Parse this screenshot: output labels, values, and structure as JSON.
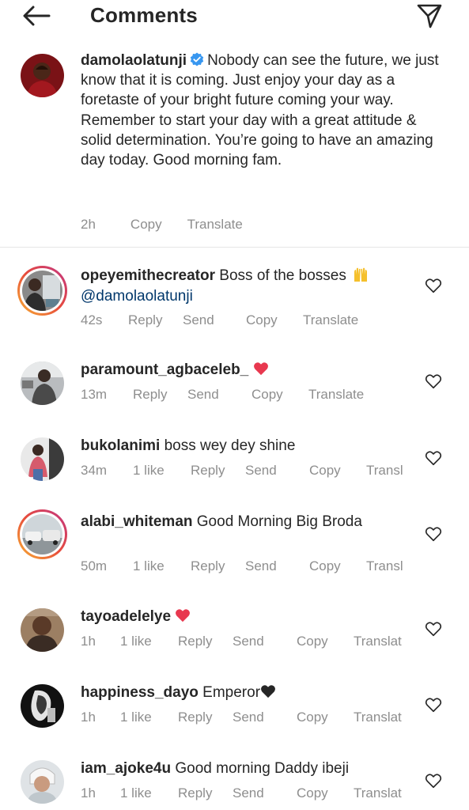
{
  "header": {
    "title": "Comments",
    "back_icon": "arrow-left-icon",
    "share_icon": "send-paper-plane-icon"
  },
  "caption": {
    "username": "damolaolatunji",
    "verified": true,
    "text": "Nobody can see the future, we just know that it is coming. Just enjoy your day as a foretaste of your bright future coming your way. Remember to start your day with a great attitude & solid determination. You’re going to have an amazing day today. Good morning fam.",
    "time": "2h",
    "copy_label": "Copy",
    "translate_label": "Translate"
  },
  "comments": [
    {
      "username": "opeyemithecreator",
      "text": "Boss of the bosses",
      "emoji": "raised-hands",
      "mention": "@damolaolatunji",
      "time": "42s",
      "actions": [
        "Reply",
        "Send",
        "Copy",
        "Translate"
      ]
    },
    {
      "username": "paramount_agbaceleb_",
      "text": "",
      "emoji": "red-heart",
      "time": "13m",
      "actions": [
        "Reply",
        "Send",
        "Copy",
        "Translate"
      ]
    },
    {
      "username": "bukolanimi",
      "text": "boss wey dey shine",
      "time": "34m",
      "likes": "1 like",
      "actions": [
        "Reply",
        "Send",
        "Copy",
        "Transl"
      ]
    },
    {
      "username": "alabi_whiteman",
      "text": "Good Morning Big Broda",
      "time": "50m",
      "likes": "1 like",
      "actions": [
        "Reply",
        "Send",
        "Copy",
        "Transl"
      ]
    },
    {
      "username": "tayoadelelye",
      "text": "",
      "emoji": "red-heart",
      "time": "1h",
      "likes": "1 like",
      "actions": [
        "Reply",
        "Send",
        "Copy",
        "Translat"
      ]
    },
    {
      "username": "happiness_dayo",
      "text": "Emperor",
      "emoji": "black-heart",
      "time": "1h",
      "likes": "1 like",
      "actions": [
        "Reply",
        "Send",
        "Copy",
        "Translat"
      ]
    },
    {
      "username": "iam_ajoke4u",
      "text": "Good morning Daddy ibeji",
      "time": "1h",
      "likes": "1 like",
      "actions": [
        "Reply",
        "Send",
        "Copy",
        "Translat"
      ]
    }
  ],
  "colors": {
    "text": "#262626",
    "secondary": "#8e8e8e",
    "verified": "#3897f0",
    "heart_red": "#e8384f",
    "mention": "#00376b"
  }
}
